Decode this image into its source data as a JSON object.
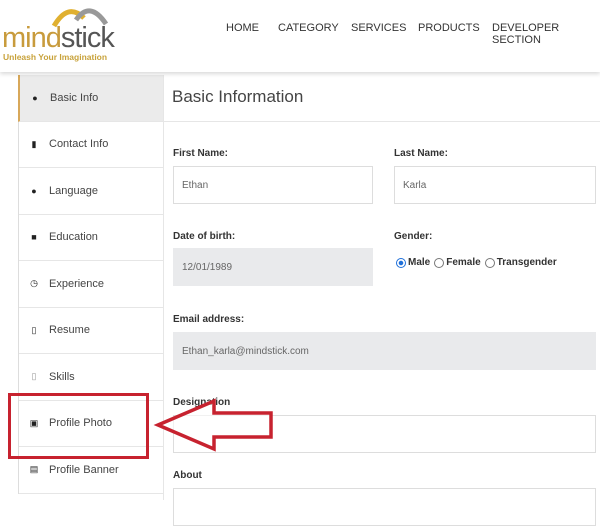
{
  "logo": {
    "word_part1": "mind",
    "word_part2": "stick",
    "tagline": "Unleash Your Imagination"
  },
  "nav": [
    "HOME",
    "CATEGORY",
    "SERVICES",
    "PRODUCTS",
    "DEVELOPER SECTION"
  ],
  "sidebar": {
    "items": [
      {
        "label": "Basic Info",
        "icon": "info-icon",
        "active": true
      },
      {
        "label": "Contact Info",
        "icon": "contact-icon"
      },
      {
        "label": "Language",
        "icon": "language-icon"
      },
      {
        "label": "Education",
        "icon": "education-icon"
      },
      {
        "label": "Experience",
        "icon": "clock-icon"
      },
      {
        "label": "Resume",
        "icon": "document-icon"
      },
      {
        "label": "Skills",
        "icon": "skills-icon"
      },
      {
        "label": "Profile Photo",
        "icon": "photo-icon"
      },
      {
        "label": "Profile Banner",
        "icon": "banner-icon"
      }
    ]
  },
  "main": {
    "title": "Basic Information",
    "first_name": {
      "label": "First Name:",
      "value": "Ethan"
    },
    "last_name": {
      "label": "Last Name:",
      "value": "Karla"
    },
    "dob": {
      "label": "Date of birth:",
      "value": "12/01/1989"
    },
    "gender": {
      "label": "Gender:",
      "options": [
        "Male",
        "Female",
        "Transgender"
      ],
      "selected": "Male"
    },
    "email": {
      "label": "Email address:",
      "value": "Ethan_karla@mindstick.com"
    },
    "designation": {
      "label": "Designation",
      "value": ""
    },
    "about": {
      "label": "About",
      "value": ""
    }
  },
  "annotation_color": "#c7222f"
}
